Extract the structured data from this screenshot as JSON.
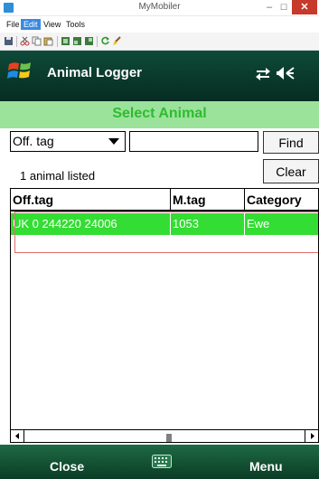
{
  "window": {
    "title": "MyMobiler",
    "minimize_label": "–",
    "maximize_label": "☐",
    "close_label": "✕"
  },
  "menubar": {
    "items": [
      {
        "label": "File"
      },
      {
        "label": "Edit",
        "selected": true
      },
      {
        "label": "View"
      },
      {
        "label": "Tools"
      }
    ]
  },
  "toolbar": {
    "icons": [
      "save-icon",
      "cut-icon",
      "copy-icon",
      "paste-icon",
      "capture-icon",
      "capture-region-icon",
      "capture-window-icon",
      "refresh-icon",
      "brush-icon"
    ]
  },
  "app": {
    "title": "Animal Logger",
    "header_bg": "#0b3a2c",
    "accent_green": "#33dd33"
  },
  "screen": {
    "title": "Select Animal",
    "title_color": "#2fbb2f",
    "title_bar_color": "#9be39b"
  },
  "search": {
    "field_selected": "Off. tag",
    "value": "",
    "find_label": "Find",
    "clear_label": "Clear"
  },
  "status": {
    "count_text": "1 animal listed"
  },
  "grid": {
    "columns": [
      "Off.tag",
      "M.tag",
      "Category"
    ],
    "rows": [
      [
        "UK 0 244220 24006",
        "1053",
        "Ewe"
      ]
    ]
  },
  "softkeys": {
    "left": "Close",
    "right": "Menu"
  }
}
